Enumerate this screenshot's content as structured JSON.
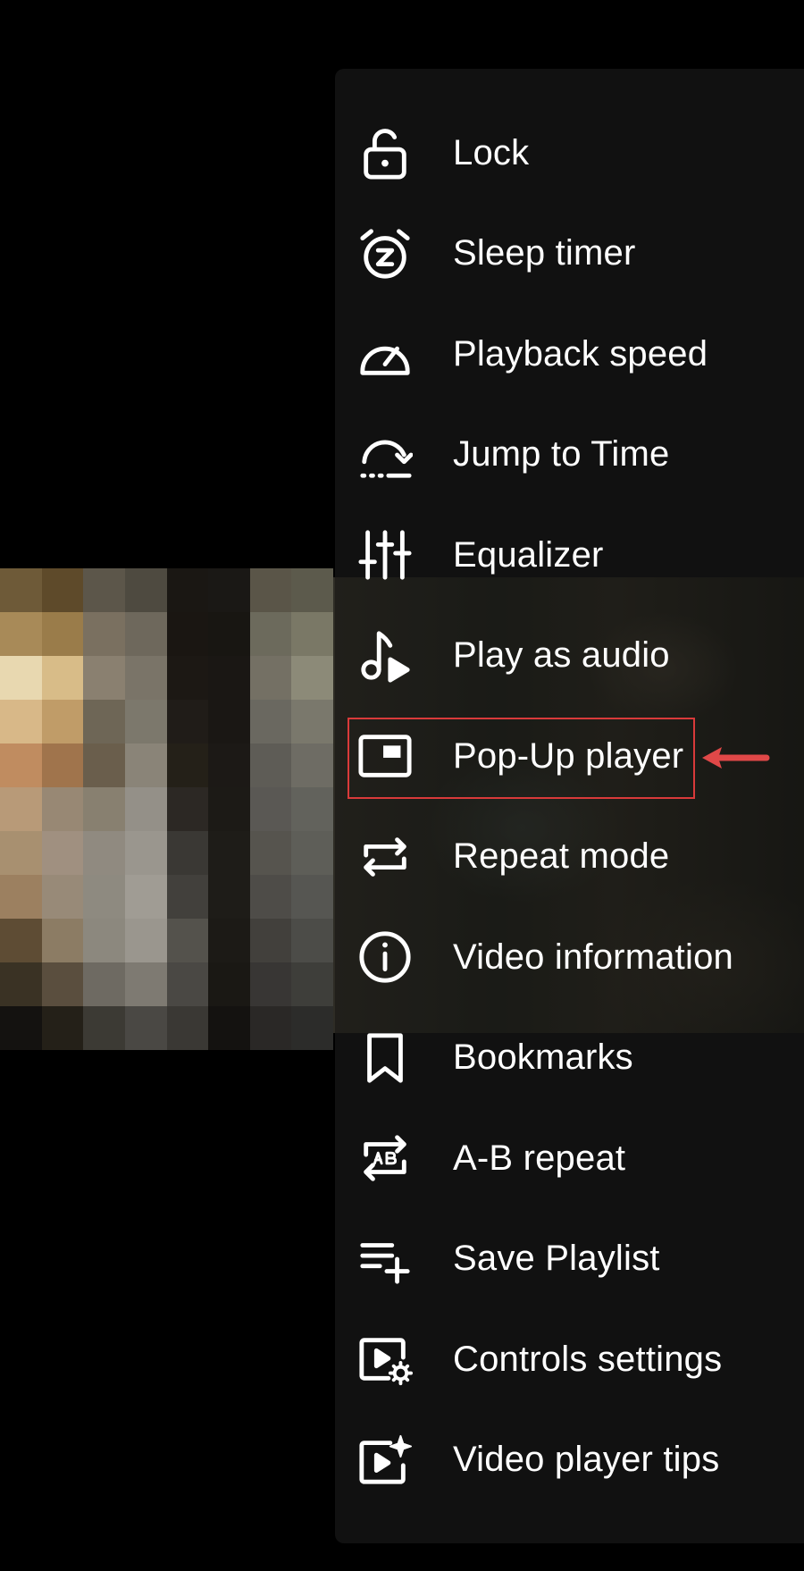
{
  "menu": {
    "items": [
      {
        "label": "Lock",
        "icon": "lock-icon"
      },
      {
        "label": "Sleep timer",
        "icon": "alarm-z-icon"
      },
      {
        "label": "Playback speed",
        "icon": "speedometer-icon"
      },
      {
        "label": "Jump to Time",
        "icon": "jump-arc-icon"
      },
      {
        "label": "Equalizer",
        "icon": "equalizer-sliders-icon"
      },
      {
        "label": "Play as audio",
        "icon": "music-note-play-icon"
      },
      {
        "label": "Pop-Up player",
        "icon": "picture-in-picture-icon"
      },
      {
        "label": "Repeat mode",
        "icon": "repeat-icon"
      },
      {
        "label": "Video information",
        "icon": "info-icon"
      },
      {
        "label": "Bookmarks",
        "icon": "bookmark-icon"
      },
      {
        "label": "A-B repeat",
        "icon": "ab-repeat-icon"
      },
      {
        "label": "Save Playlist",
        "icon": "playlist-add-icon"
      },
      {
        "label": "Controls settings",
        "icon": "video-gear-icon"
      },
      {
        "label": "Video player tips",
        "icon": "video-sparkle-icon"
      }
    ]
  },
  "annotation": {
    "highlighted_item": "Pop-Up player",
    "box_color": "#d93a3a",
    "arrow_color": "#e04848"
  },
  "colors": {
    "menu_background": "#111111",
    "text": "#ffffff",
    "page_background": "#000000"
  }
}
